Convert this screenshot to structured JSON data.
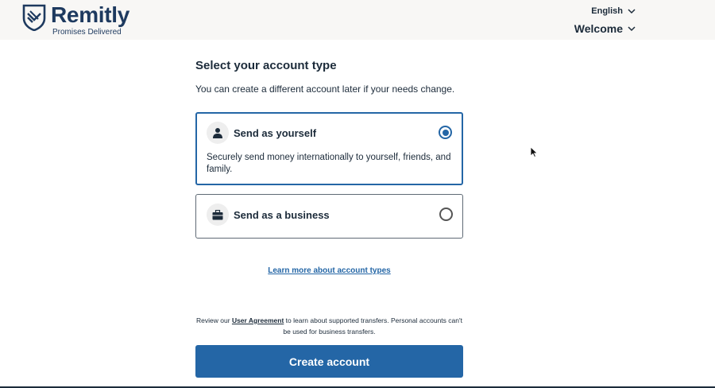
{
  "header": {
    "brand": "Remitly",
    "tagline": "Promises Delivered",
    "language": "English",
    "welcome": "Welcome"
  },
  "main": {
    "title": "Select your account type",
    "subtitle": "You can create a different account later if your needs change.",
    "options": [
      {
        "label": "Send as yourself",
        "description": "Securely send money internationally to yourself, friends, and family.",
        "icon": "person-icon",
        "selected": true
      },
      {
        "label": "Send as a business",
        "icon": "briefcase-icon",
        "selected": false
      }
    ],
    "learn_more": "Learn more about account types",
    "review": {
      "prefix": "Review our",
      "link": "User Agreement",
      "suffix": "to learn about supported transfers. Personal accounts can't be used for business transfers."
    },
    "create_button": "Create account"
  },
  "colors": {
    "brand": "#1e3a5f",
    "accent": "#2466a6",
    "header_bg": "#f8f7f5"
  }
}
